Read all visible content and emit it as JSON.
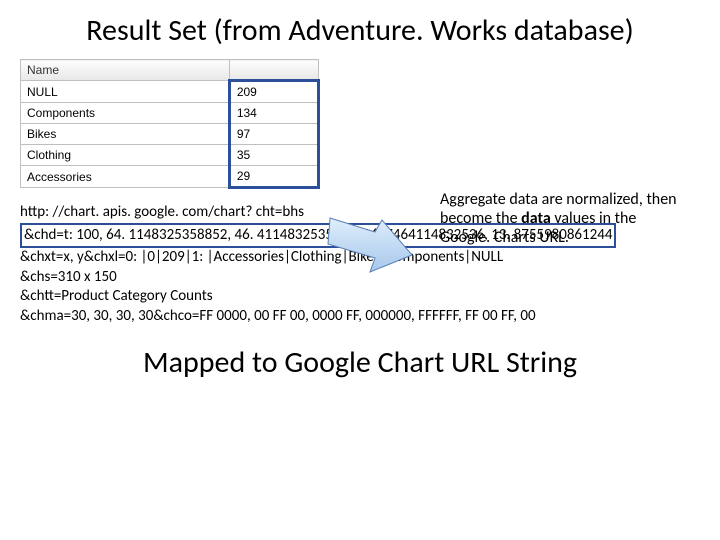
{
  "title": "Result Set (from Adventure. Works database)",
  "table": {
    "header": [
      "Name",
      ""
    ],
    "rows": [
      {
        "name": "NULL",
        "value": "209"
      },
      {
        "name": "Components",
        "value": "134"
      },
      {
        "name": "Bikes",
        "value": "97"
      },
      {
        "name": "Clothing",
        "value": "35"
      },
      {
        "name": "Accessories",
        "value": "29"
      }
    ]
  },
  "callout": "Aggregate data are normalized, then become the data values in the Google. Charts URL.",
  "callout_bold": "data",
  "url_lines": {
    "l1": "http: //chart. apis. google. com/chart? cht=bhs",
    "l2": "&chd=t: 100, 64. 1148325358852, 46. 4114832535885, 16. 7464114832536, 13. 8755980861244",
    "l3": "&chxt=x, y&chxl=0: |0|209|1: |Accessories|Clothing|Bikes|Components|NULL",
    "l4": "&chs=310 x 150",
    "l5": "&chtt=Product Category Counts",
    "l6": "&chma=30, 30, 30, 30&chco=FF 0000, 00 FF 00, 0000 FF, 000000, FFFFFF, FF 00 FF, 00"
  },
  "footer": "Mapped to Google Chart URL String"
}
